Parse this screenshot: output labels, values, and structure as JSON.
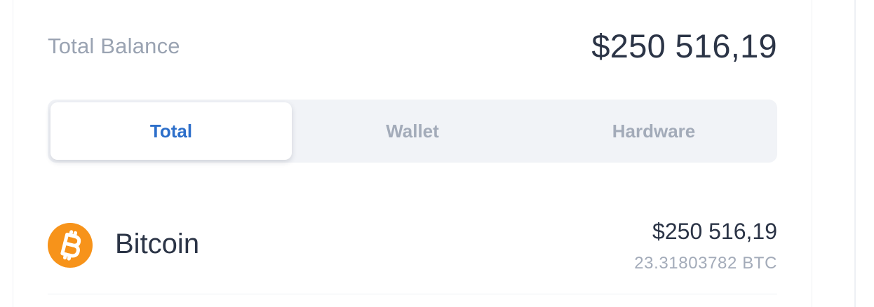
{
  "balance": {
    "label": "Total Balance",
    "amount": "$250 516,19"
  },
  "tabs": [
    {
      "label": "Total",
      "active": true
    },
    {
      "label": "Wallet",
      "active": false
    },
    {
      "label": "Hardware",
      "active": false
    }
  ],
  "assets": [
    {
      "icon": "bitcoin-icon",
      "name": "Bitcoin",
      "value": "$250 516,19",
      "amount": "23.31803782 BTC"
    }
  ],
  "colors": {
    "accent": "#2d6fca",
    "text_primary": "#2b3446",
    "text_muted": "#9aa3b2",
    "tab_track": "#f1f3f7",
    "bitcoin_orange": "#f7931a"
  }
}
